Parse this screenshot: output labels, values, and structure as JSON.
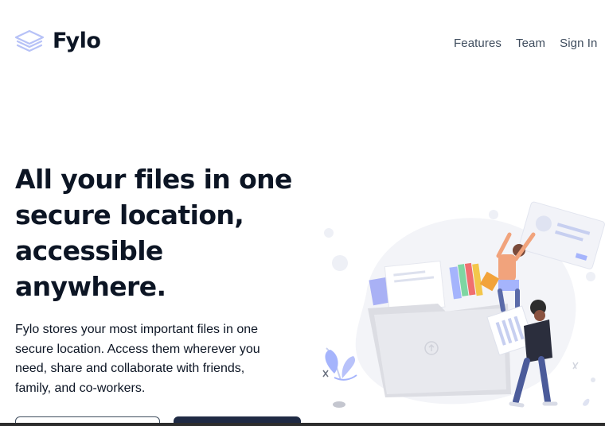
{
  "brand": {
    "name": "Fylo"
  },
  "nav": {
    "items": [
      "Features",
      "Team",
      "Sign In"
    ]
  },
  "hero": {
    "title": "All your files in one secure location, accessible anywhere.",
    "description": "Fylo stores your most important files in one secure location. Access them wherever you need, share and collaborate with friends, family, and co-workers."
  },
  "colors": {
    "text_dark": "#0c1524",
    "nav_text": "#3f4d5e",
    "button_dark": "#1f2a44",
    "logo_layers": "#a5b4fc"
  },
  "icons": {
    "logo": "layers-icon"
  }
}
